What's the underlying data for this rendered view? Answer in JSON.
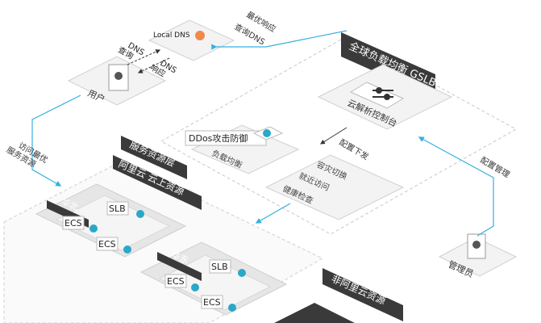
{
  "gslb": {
    "title": "全球负载均衡 GSLB",
    "console_label": "云解析控制台"
  },
  "dns": {
    "local_dns_label": "Local DNS",
    "dns_query_label": "DNS\n查询",
    "dns_response_label": "DNS\n响应",
    "nearest_response_label": "最优响应",
    "query_dns_label": "查询DNS"
  },
  "user": {
    "label": "用户"
  },
  "admin": {
    "label": "管理员"
  },
  "edges": {
    "access_label": "访问最优\n服务资源",
    "config_deliver_label": "配置下发",
    "config_manage_label": "配置管理"
  },
  "functions": {
    "ddos_label": "DDos攻击防御",
    "load_balance_label": "负载均衡",
    "failover_label": "容灾切换",
    "nearest_access_label": "就近访问",
    "health_check_label": "健康检查"
  },
  "service_layer": {
    "title": "服务资源层",
    "aliyun_title": "阿里云 云上资源",
    "north_label": "华北",
    "east_label": "华东",
    "slb_label": "SLB",
    "ecs_label": "ECS",
    "non_aliyun_title": "非阿里云资源"
  }
}
